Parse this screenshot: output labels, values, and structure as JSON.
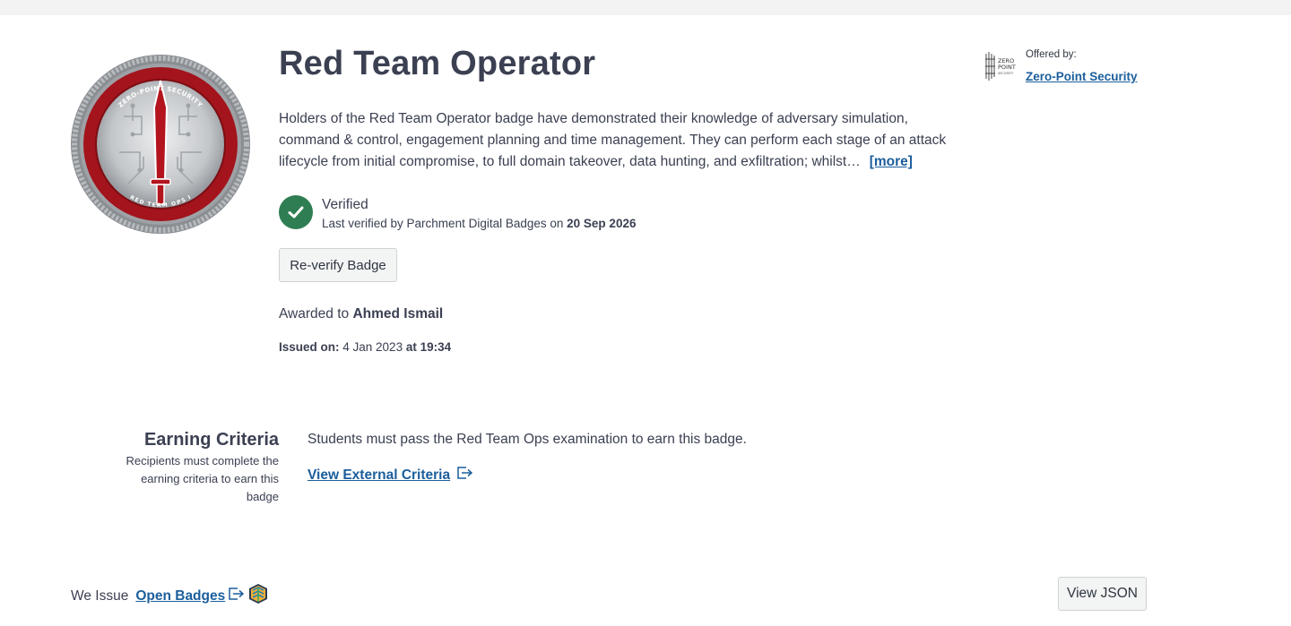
{
  "badge": {
    "title": "Red Team Operator",
    "description": "Holders of the Red Team Operator badge have demonstrated their knowledge of adversary simulation, command & control, engagement planning and time management. They can perform each stage of an attack lifecycle from initial compromise, to full domain takeover, data hunting, and exfiltration; whilst…",
    "more_label": "[more]",
    "coin_top_text": "ZERO-POINT SECURITY",
    "coin_bottom_text": "RED TEAM OPS I",
    "image_icon": "red-team-ops-badge-image"
  },
  "verification": {
    "status": "Verified",
    "prefix": "Last verified by Parchment Digital Badges on ",
    "date": "20 Sep 2026",
    "reverify_label": "Re-verify Badge",
    "icon": "check-circle-icon",
    "color": "#2f7d52"
  },
  "award": {
    "prefix": "Awarded to ",
    "recipient": "Ahmed Ismail",
    "issued_label": "Issued on:",
    "issued_date": " 4 Jan 2023 ",
    "issued_at": "at 19:34"
  },
  "issuer": {
    "offered_label": "Offered by:",
    "name": "Zero-Point Security",
    "logo_text": "ZERO POINT",
    "logo_subtext": "SECURITY"
  },
  "criteria": {
    "heading": "Earning Criteria",
    "subtext": "Recipients must complete the earning criteria to earn this badge",
    "text": "Students must pass the Red Team Ops examination to earn this badge.",
    "link_label": "View External Criteria"
  },
  "footer": {
    "we_issue": "We Issue",
    "open_badges": "Open Badges",
    "view_json": "View JSON"
  },
  "colors": {
    "link": "#1b5e9c",
    "text": "#3b4052",
    "button_bg": "#f3f4f4"
  }
}
